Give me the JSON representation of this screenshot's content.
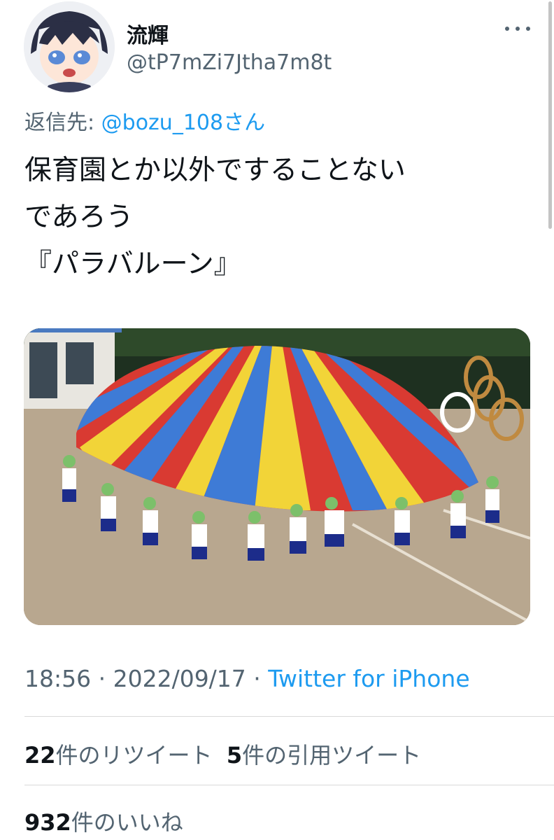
{
  "tweet": {
    "author": {
      "display_name": "流輝",
      "handle": "@tP7mZi7Jtha7m8t"
    },
    "reply_to": {
      "label": "返信先: ",
      "mention": "@bozu_108さん"
    },
    "text_lines": [
      "保育園とか以外ですることない",
      "であろう",
      "『パラバルーン』"
    ],
    "time": "18:56",
    "separator": " · ",
    "date": "2022/09/17",
    "source": "Twitter for iPhone",
    "retweets": {
      "count": "22",
      "label": "件のリツイート"
    },
    "quotes": {
      "count": "5",
      "label": "件の引用ツイート"
    },
    "likes": {
      "count": "932",
      "label": "件のいいね"
    }
  },
  "icons": {
    "more": "more-dots-icon"
  },
  "colors": {
    "accent": "#1d9bf0",
    "secondary_text": "#536471",
    "primary_text": "#0f1419",
    "divider": "#d9d9d9"
  }
}
